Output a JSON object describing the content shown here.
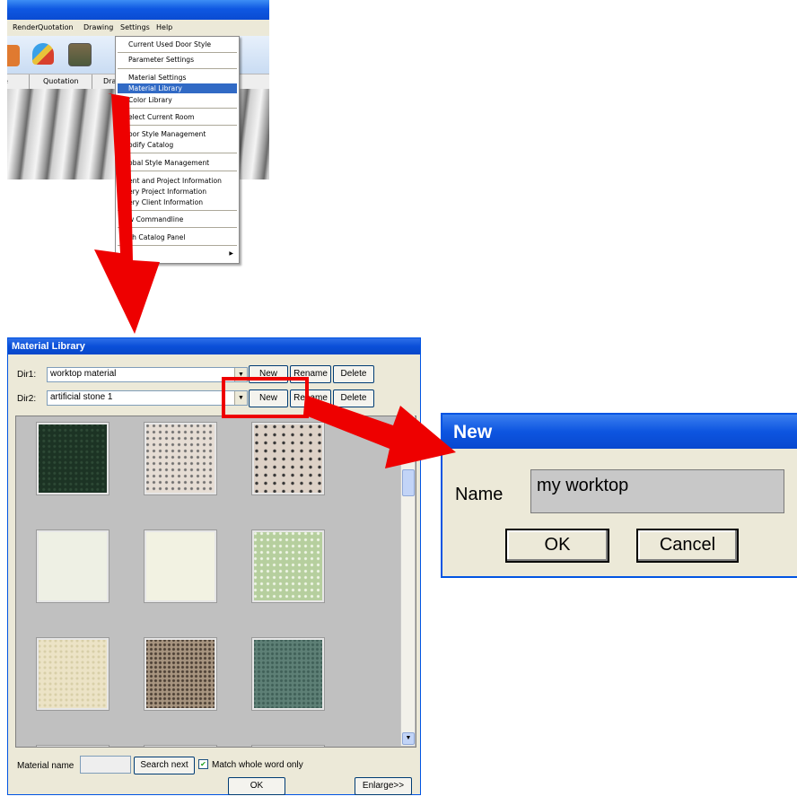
{
  "app": {
    "menubar": [
      "Render",
      "Quotation",
      "Drawing",
      "Settings",
      "Help"
    ],
    "tabs": [
      "e",
      "Quotation",
      "Dra"
    ]
  },
  "settings_menu": {
    "items": [
      "Current Used Door Style",
      "Parameter Settings",
      "Material Settings",
      "Material Library",
      "Color Library",
      "elect Current Room",
      "oor Style Management",
      "odify Catalog",
      "obal Style Management",
      "ent and Project Information",
      "ery Project Information",
      "ery Client Information",
      "w Commandline",
      "ch Catalog Panel"
    ],
    "selected": "Material Library"
  },
  "material_library": {
    "title": "Material Library",
    "dir1_label": "Dir1:",
    "dir1_value": "worktop material",
    "dir2_label": "Dir2:",
    "dir2_value": "artificial stone 1",
    "new_label": "New",
    "rename_label": "Rename",
    "delete_label": "Delete",
    "material_name_label": "Material name",
    "search_next_label": "Search next",
    "match_whole_word_label": "Match whole word only",
    "match_whole_word_checked": true,
    "ok_label": "OK",
    "enlarge_label": "Enlarge>>",
    "swatch_colors": [
      "#1c3324",
      "#e6ddd4",
      "#ddd1c6",
      "#eef0e4",
      "#f2f2e2",
      "#b6cf9e",
      "#ece3c6",
      "#a89580",
      "#5e8076"
    ]
  },
  "new_dialog": {
    "title": "New",
    "name_label": "Name",
    "name_value": "my worktop",
    "ok_label": "OK",
    "cancel_label": "Cancel"
  },
  "colors": {
    "arrow_red": "#ee0000",
    "highlight_blue": "#316ac5",
    "titlebar_blue": "#0a4fd8"
  }
}
